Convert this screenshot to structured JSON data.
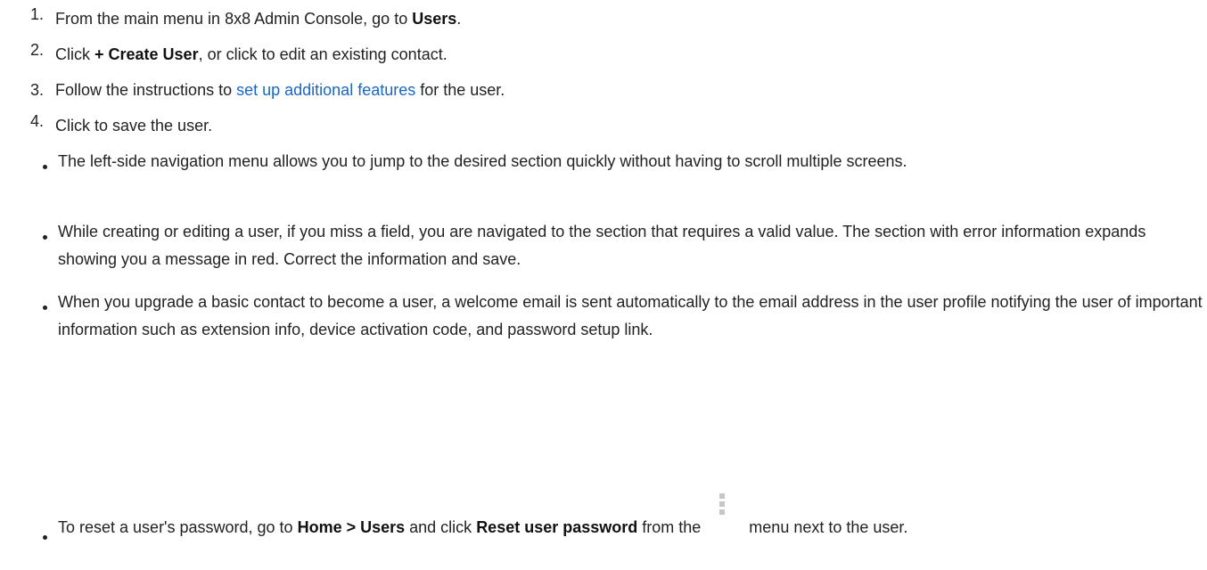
{
  "steps": [
    {
      "num": "1.",
      "pre": "From the main menu in 8x8 Admin Console, go to ",
      "bold": "Users",
      "post": "."
    },
    {
      "num": "2.",
      "pre": "Click ",
      "bold": "+ Create User",
      "post": ", or click to edit an existing contact."
    },
    {
      "num": "3.",
      "pre": "Follow the instructions to ",
      "link": "set up additional features",
      "post": " for the user."
    },
    {
      "num": "4.",
      "pre": "Click to save the user."
    }
  ],
  "bullets": [
    {
      "text": "The left-side navigation menu allows you to jump to the desired section quickly without having to scroll multiple screens."
    },
    {
      "text": "While creating or editing a user, if you miss a field, you are navigated to the section that requires a valid value. The section with error information expands showing you a message in red. Correct the information and save."
    },
    {
      "text": "When you upgrade a basic contact to become a user, a welcome email is sent automatically to the email address in the user profile notifying the user of important information such as extension info, device activation code, and password setup link."
    },
    {
      "pre": "To reset a user's password, go to ",
      "bold1": "Home > Users",
      "mid": " and click ",
      "bold2": "Reset user password",
      "mid2": " from the ",
      "post": " menu next to the user.",
      "icon": "vertical-ellipsis-icon"
    }
  ]
}
